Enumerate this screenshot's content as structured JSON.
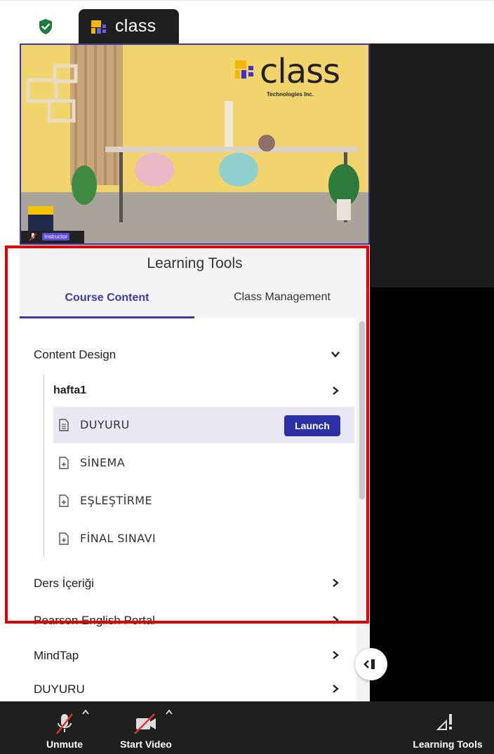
{
  "browser_tab": {
    "title": "class"
  },
  "video": {
    "brand_name": "class",
    "brand_sub": "Technologies Inc.",
    "badge": "Instructor"
  },
  "panel": {
    "title": "Learning Tools",
    "tabs": [
      {
        "label": "Course Content",
        "active": true
      },
      {
        "label": "Class Management",
        "active": false
      }
    ]
  },
  "tree": {
    "content_design": "Content Design",
    "hafta1": "hafta1",
    "lessons": [
      {
        "label": "DUYURU",
        "action": "Launch"
      },
      {
        "label": "SİNEMA"
      },
      {
        "label": "EŞLEŞTİRME"
      },
      {
        "label": "FİNAL SINAVI"
      }
    ],
    "sections": [
      {
        "label": "Ders İçeriği"
      },
      {
        "label": "Pearson English Portal"
      },
      {
        "label": "MindTap"
      },
      {
        "label": "DUYURU"
      }
    ]
  },
  "toolbar": {
    "unmute": "Unmute",
    "start_video": "Start Video",
    "learning_tools": "Learning Tools"
  },
  "colors": {
    "accent": "#3b3aa6",
    "launch": "#2d2fa4",
    "highlight": "#e00000",
    "toolbar": "#1f1f1f"
  }
}
